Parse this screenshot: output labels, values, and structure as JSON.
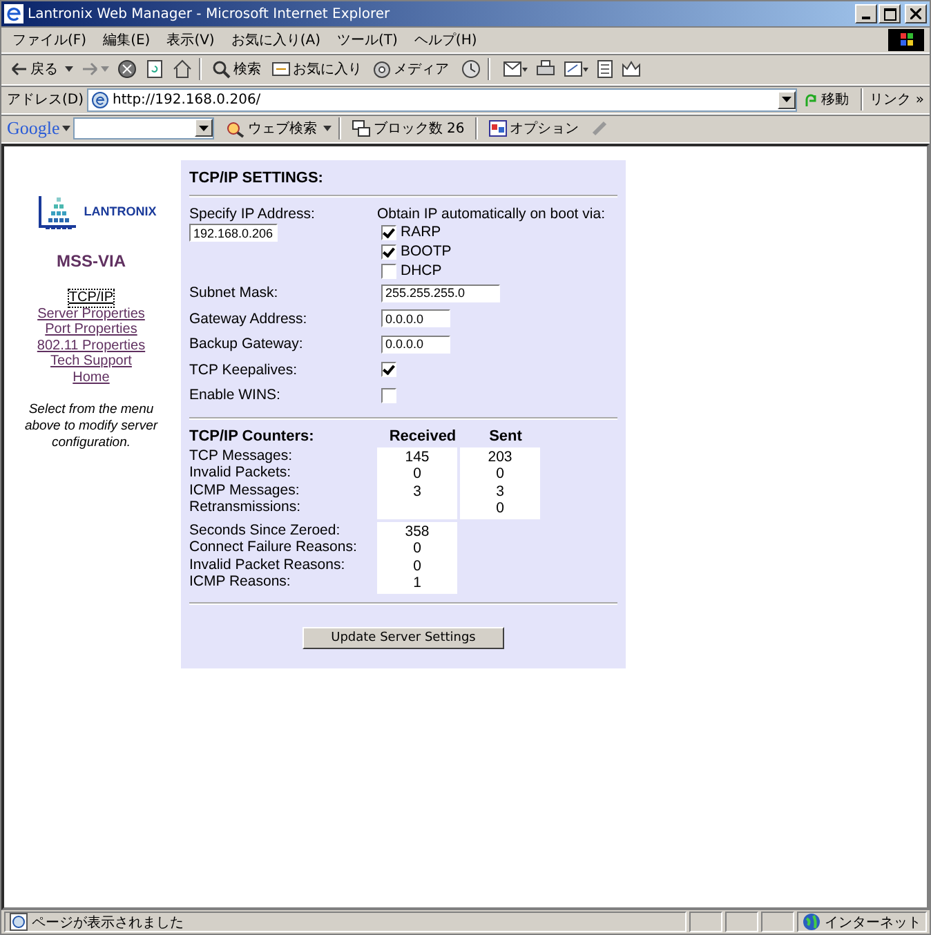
{
  "window": {
    "title": "Lantronix Web Manager - Microsoft Internet Explorer"
  },
  "menu": [
    "ファイル(F)",
    "編集(E)",
    "表示(V)",
    "お気に入り(A)",
    "ツール(T)",
    "ヘルプ(H)"
  ],
  "toolbar": {
    "back": "戻る",
    "search": "検索",
    "favorites": "お気に入り",
    "media": "メディア"
  },
  "address": {
    "label": "アドレス(D)",
    "value": "http://192.168.0.206/",
    "go": "移動",
    "links": "リンク »"
  },
  "google_bar": {
    "logo": "Google",
    "search": "ウェブ検索",
    "blocked": "ブロック数 26",
    "options": "オプション"
  },
  "sidebar": {
    "brand": "LANTRONIX",
    "product": "MSS-VIA",
    "items": [
      {
        "label": "TCP/IP",
        "selected": true
      },
      {
        "label": "Server Properties",
        "selected": false
      },
      {
        "label": "Port Properties",
        "selected": false
      },
      {
        "label": "802.11 Properties",
        "selected": false
      },
      {
        "label": "Tech Support",
        "selected": false
      },
      {
        "label": "Home",
        "selected": false
      }
    ],
    "help": "Select from the menu above to modify server configuration."
  },
  "settings": {
    "title": "TCP/IP SETTINGS:",
    "ip_label": "Specify IP Address:",
    "ip_value": "192.168.0.206",
    "obtain_label": "Obtain IP automatically on boot via:",
    "boot_options": [
      {
        "label": "RARP",
        "checked": true
      },
      {
        "label": "BOOTP",
        "checked": true
      },
      {
        "label": "DHCP",
        "checked": false
      }
    ],
    "rows": [
      {
        "kind": "text",
        "label": "Subnet Mask:",
        "value": "255.255.255.0"
      },
      {
        "kind": "text",
        "label": "Gateway Address:",
        "value": "0.0.0.0"
      },
      {
        "kind": "text",
        "label": "Backup Gateway:",
        "value": "0.0.0.0"
      },
      {
        "kind": "checkbox",
        "label": "TCP Keepalives:",
        "checked": true
      },
      {
        "kind": "checkbox",
        "label": "Enable WINS:",
        "checked": false
      }
    ]
  },
  "counters": {
    "title": "TCP/IP Counters:",
    "columns": [
      "Received",
      "Sent"
    ],
    "messages": [
      {
        "label": "TCP Messages:",
        "received": "145",
        "sent": "203"
      },
      {
        "label": "Invalid Packets:",
        "received": "0",
        "sent": "0"
      },
      {
        "label": "ICMP Messages:",
        "received": "3",
        "sent": "3"
      },
      {
        "label": "Retransmissions:",
        "sent": "0"
      }
    ],
    "reasons": [
      {
        "label": "Seconds Since Zeroed:",
        "received": "358"
      },
      {
        "label": "Connect Failure Reasons:",
        "received": "0"
      },
      {
        "label": "Invalid Packet Reasons:",
        "received": "0"
      },
      {
        "label": "ICMP Reasons:",
        "received": "1"
      }
    ]
  },
  "submit": "Update Server Settings",
  "status_bar": {
    "text": "ページが表示されました",
    "zone": "インターネット"
  }
}
